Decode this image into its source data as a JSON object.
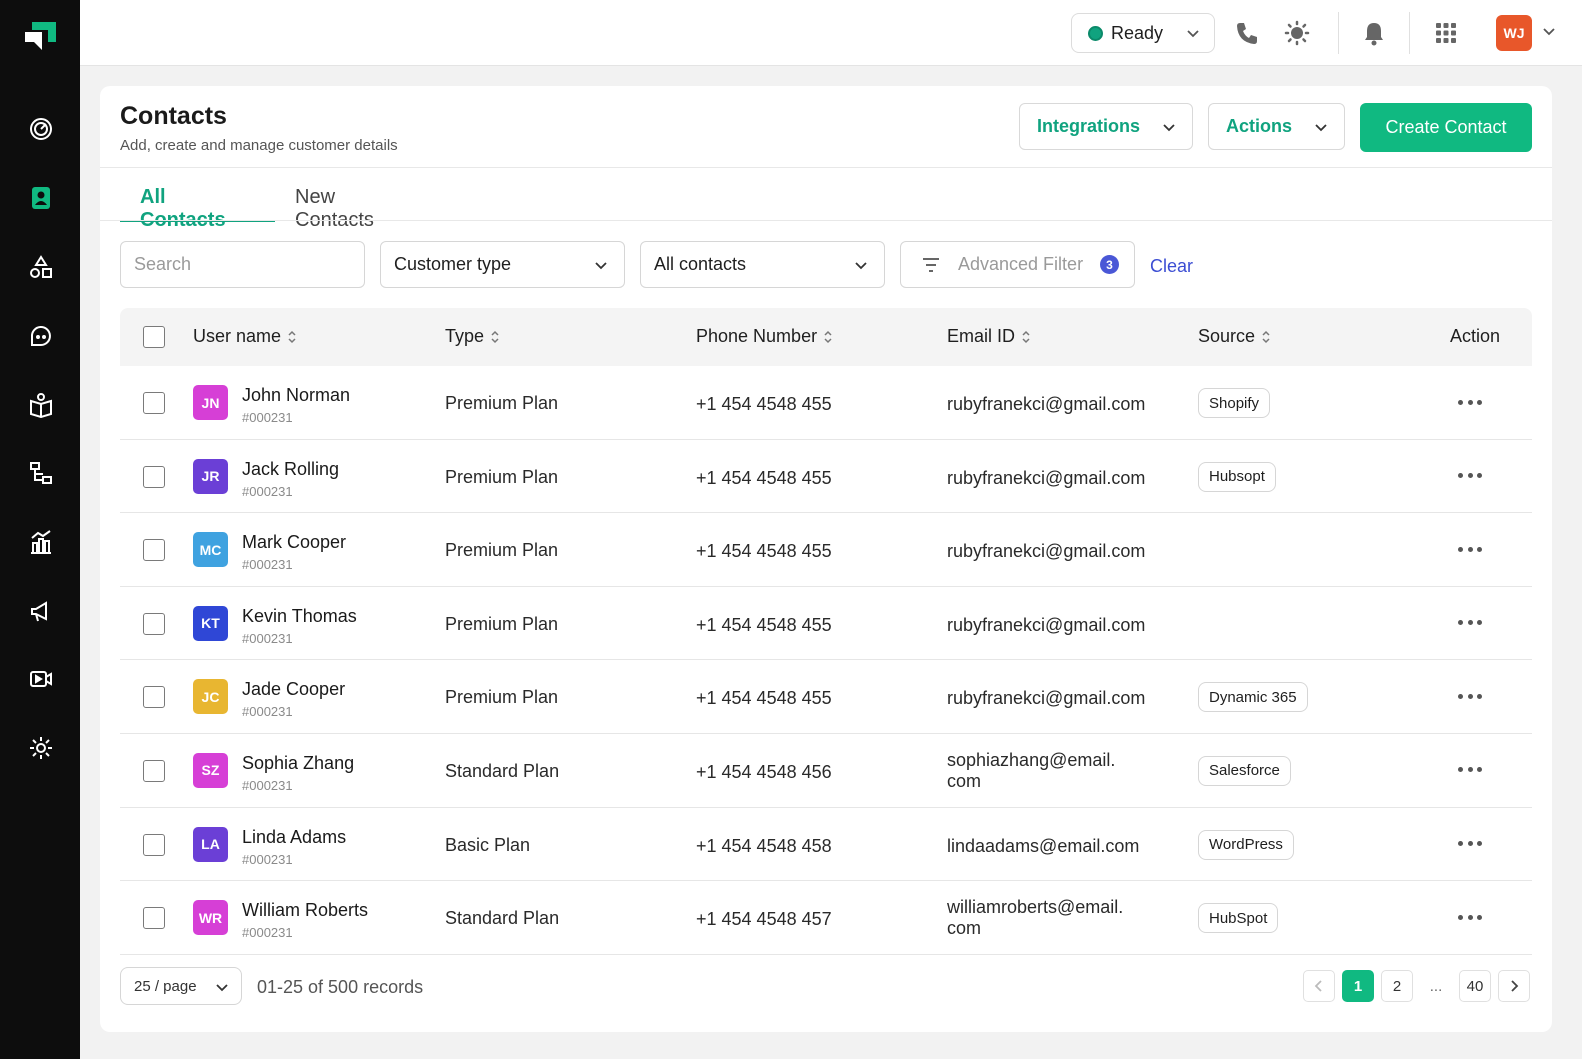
{
  "topbar": {
    "status_label": "Ready",
    "avatar_initials": "WJ"
  },
  "sidebar": {
    "items": [
      {
        "icon": "dashboard-icon"
      },
      {
        "icon": "contacts-icon",
        "active": true
      },
      {
        "icon": "shapes-icon"
      },
      {
        "icon": "chat-icon"
      },
      {
        "icon": "knowledge-icon"
      },
      {
        "icon": "flow-icon"
      },
      {
        "icon": "analytics-icon"
      },
      {
        "icon": "campaign-icon"
      },
      {
        "icon": "video-icon"
      },
      {
        "icon": "settings-icon"
      }
    ]
  },
  "header": {
    "title": "Contacts",
    "subtitle": "Add, create and manage customer details",
    "integrations_label": "Integrations",
    "actions_label": "Actions",
    "create_label": "Create Contact"
  },
  "tabs": [
    {
      "label": "All Contacts",
      "active": true
    },
    {
      "label": "New Contacts",
      "active": false
    }
  ],
  "filters": {
    "search_placeholder": "Search",
    "customer_type": "Customer type",
    "contacts_scope": "All contacts",
    "advanced_filter": "Advanced Filter",
    "advanced_filter_count": "3",
    "clear_label": "Clear"
  },
  "table": {
    "columns": [
      "User name",
      "Type",
      "Phone Number",
      "Email ID",
      "Source",
      "Action"
    ],
    "rows": [
      {
        "initials": "JN",
        "color": "#d63fd6",
        "name": "John Norman",
        "id": "#000231",
        "type": "Premium Plan",
        "phone": "+1 454 4548 455",
        "email": "rubyfranekci@gmail.com",
        "email2": "",
        "source": "Shopify"
      },
      {
        "initials": "JR",
        "color": "#6b3fd6",
        "name": "Jack Rolling",
        "id": "#000231",
        "type": "Premium Plan",
        "phone": "+1 454 4548 455",
        "email": "rubyfranekci@gmail.com",
        "email2": "",
        "source": "Hubsopt"
      },
      {
        "initials": "MC",
        "color": "#3fa2e0",
        "name": "Mark Cooper",
        "id": "#000231",
        "type": "Premium Plan",
        "phone": "+1 454 4548 455",
        "email": "rubyfranekci@gmail.com",
        "email2": "",
        "source": ""
      },
      {
        "initials": "KT",
        "color": "#2f47d6",
        "name": "Kevin Thomas",
        "id": "#000231",
        "type": "Premium Plan",
        "phone": "+1 454 4548 455",
        "email": "rubyfranekci@gmail.com",
        "email2": "",
        "source": ""
      },
      {
        "initials": "JC",
        "color": "#e8b631",
        "name": "Jade Cooper",
        "id": "#000231",
        "type": "Premium Plan",
        "phone": "+1 454 4548 455",
        "email": "rubyfranekci@gmail.com",
        "email2": "",
        "source": "Dynamic 365"
      },
      {
        "initials": "SZ",
        "color": "#d63fd6",
        "name": "Sophia Zhang",
        "id": "#000231",
        "type": "Standard Plan",
        "phone": "+1 454 4548 456",
        "email": "sophiazhang@email.",
        "email2": "com",
        "source": "Salesforce"
      },
      {
        "initials": "LA",
        "color": "#6b3fd6",
        "name": "Linda Adams",
        "id": "#000231",
        "type": "Basic Plan",
        "phone": "+1 454 4548 458",
        "email": "lindaadams@email.com",
        "email2": "",
        "source": "WordPress"
      },
      {
        "initials": "WR",
        "color": "#d63fd6",
        "name": "William Roberts",
        "id": "#000231",
        "type": "Standard Plan",
        "phone": "+1 454 4548 457",
        "email": "williamroberts@email.",
        "email2": "com",
        "source": "HubSpot"
      }
    ]
  },
  "footer": {
    "page_size": "25 / page",
    "records": "01-25 of 500 records",
    "pages": [
      "1",
      "2",
      "...",
      "40"
    ],
    "current_page": "1"
  },
  "colors": {
    "accent": "#10b981",
    "accent_text": "#10a37f",
    "link": "#3b4dd3",
    "sidebar_bg": "#0d0d0d"
  }
}
